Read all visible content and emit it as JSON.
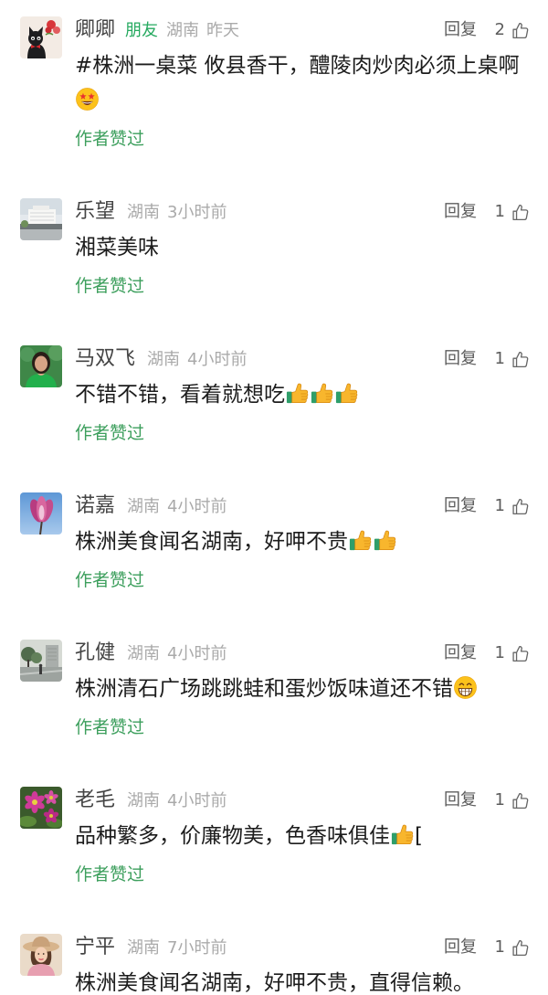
{
  "labels": {
    "reply": "回复",
    "author_liked": "作者赞过"
  },
  "colors": {
    "friend_tag": "#25a95f",
    "author_liked": "#3d9f5d",
    "meta_gray": "#aaaaaa",
    "name": "#444444",
    "text": "#1c1c1c"
  },
  "icons": {
    "like": "thumbs-up-outline-icon"
  },
  "comments": [
    {
      "name": "卿卿",
      "tag": "朋友",
      "location": "湖南",
      "time": "昨天",
      "likes": 2,
      "content": [
        {
          "text": "#株洲一桌菜 攸县香干，醴陵肉炒肉必须上桌啊"
        },
        {
          "emoji": "star-struck-icon"
        }
      ]
    },
    {
      "name": "乐望",
      "location": "湖南",
      "time": "3小时前",
      "likes": 1,
      "content": [
        {
          "text": "湘菜美味"
        }
      ]
    },
    {
      "name": "马双飞",
      "location": "湖南",
      "time": "4小时前",
      "likes": 1,
      "content": [
        {
          "text": "不错不错，看着就想吃"
        },
        {
          "emoji": "thumbs-up-icon"
        },
        {
          "emoji": "thumbs-up-icon"
        },
        {
          "emoji": "thumbs-up-icon"
        }
      ]
    },
    {
      "name": "诺嘉",
      "location": "湖南",
      "time": "4小时前",
      "likes": 1,
      "content": [
        {
          "text": "株洲美食闻名湖南，好呷不贵"
        },
        {
          "emoji": "thumbs-up-icon"
        },
        {
          "emoji": "thumbs-up-icon"
        }
      ]
    },
    {
      "name": "孔健",
      "location": "湖南",
      "time": "4小时前",
      "likes": 1,
      "content": [
        {
          "text": "株洲清石广场跳跳蛙和蛋炒饭味道还不错"
        },
        {
          "emoji": "grinning-icon"
        }
      ]
    },
    {
      "name": "老毛",
      "location": "湖南",
      "time": "4小时前",
      "likes": 1,
      "content": [
        {
          "text": "品种繁多，价廉物美，色香味俱佳"
        },
        {
          "emoji": "thumbs-up-icon"
        },
        {
          "text": "["
        }
      ]
    },
    {
      "name": "宁平",
      "location": "湖南",
      "time": "7小时前",
      "likes": 1,
      "content": [
        {
          "text": "株洲美食闻名湖南，好呷不贵，直得信赖。"
        }
      ]
    }
  ]
}
